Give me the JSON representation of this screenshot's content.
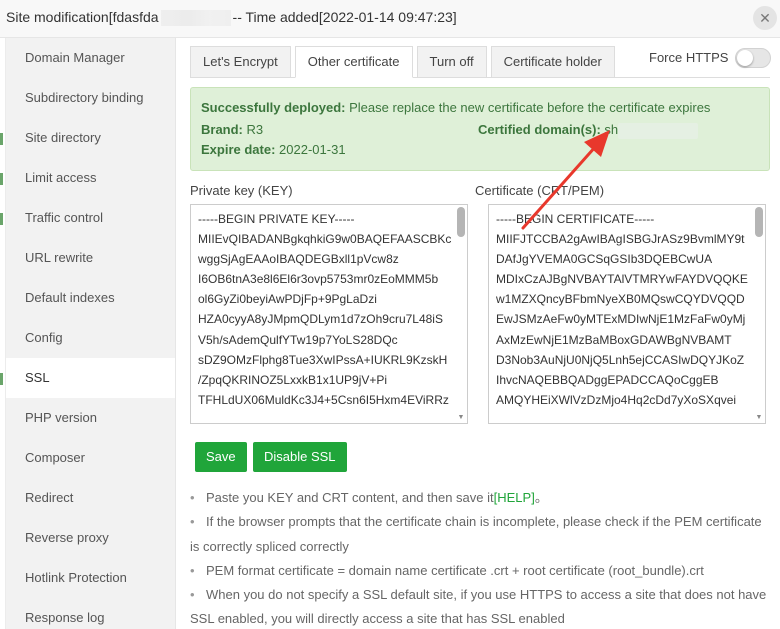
{
  "window": {
    "title_prefix": "Site modification[fdasfda",
    "title_suffix": "-- Time added[2022-01-14 09:47:23]",
    "close_icon": "close-icon"
  },
  "sidebar": {
    "items": [
      {
        "label": "Domain Manager",
        "active": false
      },
      {
        "label": "Subdirectory binding",
        "active": false
      },
      {
        "label": "Site directory",
        "active": false
      },
      {
        "label": "Limit access",
        "active": false
      },
      {
        "label": "Traffic control",
        "active": false
      },
      {
        "label": "URL rewrite",
        "active": false
      },
      {
        "label": "Default indexes",
        "active": false
      },
      {
        "label": "Config",
        "active": false
      },
      {
        "label": "SSL",
        "active": true
      },
      {
        "label": "PHP version",
        "active": false
      },
      {
        "label": "Composer",
        "active": false
      },
      {
        "label": "Redirect",
        "active": false
      },
      {
        "label": "Reverse proxy",
        "active": false
      },
      {
        "label": "Hotlink Protection",
        "active": false
      },
      {
        "label": "Response log",
        "active": false
      }
    ]
  },
  "tabs": [
    {
      "label": "Let's Encrypt",
      "active": false
    },
    {
      "label": "Other certificate",
      "active": true
    },
    {
      "label": "Turn off",
      "active": false
    },
    {
      "label": "Certificate holder",
      "active": false
    }
  ],
  "force_https": {
    "label": "Force HTTPS",
    "enabled": false
  },
  "notice": {
    "deployed_label": "Successfully deployed:",
    "deployed_text": "Please replace the new certificate before the certificate expires",
    "brand_label": "Brand:",
    "brand_value": "R3",
    "domain_label": "Certified domain(s):",
    "domain_value": "sh",
    "expire_label": "Expire date:",
    "expire_value": "2022-01-31"
  },
  "private_key": {
    "label": "Private key (KEY)",
    "content": "-----BEGIN PRIVATE KEY-----\nMIIEvQIBADANBgkqhkiG9w0BAQEFAASCBKc\nwggSjAgEAAoIBAQDEGBxll1pVcw8z\nI6OB6tnA3e8l6El6r3ovp5753mr0zEoMMM5b\nol6GyZi0beyiAwPDjFp+9PgLaDzi\nHZA0cyyA8yJMpmQDLym1d7zOh9cru7L48iS\nV5h/sAdemQulfYTw19p7YoLS28DQc\nsDZ9OMzFlphg8Tue3XwIPssA+IUKRL9KzskH\n/ZpqQKRINOZ5LxxkB1x1UP9jV+Pi\nTFHLdUX06MuldKc3J4+5Csn6I5Hxm4EViRRz"
  },
  "certificate": {
    "label": "Certificate (CRT/PEM)",
    "content": "-----BEGIN CERTIFICATE-----\nMIIFJTCCBA2gAwIBAgISBGJrASz9BvmlMY9t\nDAfJgYVEMA0GCSqGSIb3DQEBCwUA\nMDIxCzAJBgNVBAYTAlVTMRYwFAYDVQQKE\nw1MZXQncyBFbmNyeXB0MQswCQYDVQQD\nEwJSMzAeFw0yMTExMDIwNjE1MzFaFw0yMj\nAxMzEwNjE1MzBaMBoxGDAWBgNVBAMT\nD3Nob3AuNjU0NjQ5Lnh5ejCCASIwDQYJKoZ\nIhvcNAQEBBQADggEPADCCAQoCggEB\nAMQYHEiXWlVzDzMjo4Hq2cDd7yXoSXqvei"
  },
  "buttons": {
    "save": "Save",
    "disable_ssl": "Disable SSL"
  },
  "tips": {
    "tip1_text": "Paste you KEY and CRT content, and then save it",
    "tip1_link": "[HELP]",
    "tip1_end": "。",
    "tip2": "If the browser prompts that the certificate chain is incomplete, please check if the PEM certificate is correctly spliced correctly",
    "tip3": "PEM format certificate = domain name certificate .crt + root certificate (root_bundle).crt",
    "tip4": "When you do not specify a SSL default site, if you use HTTPS to access a site that does not have SSL enabled, you will directly access a site that has SSL enabled"
  },
  "colors": {
    "accent": "#20a53a",
    "notice_bg": "#dff0d8",
    "notice_text": "#3c763d",
    "arrow": "#e8382c"
  }
}
